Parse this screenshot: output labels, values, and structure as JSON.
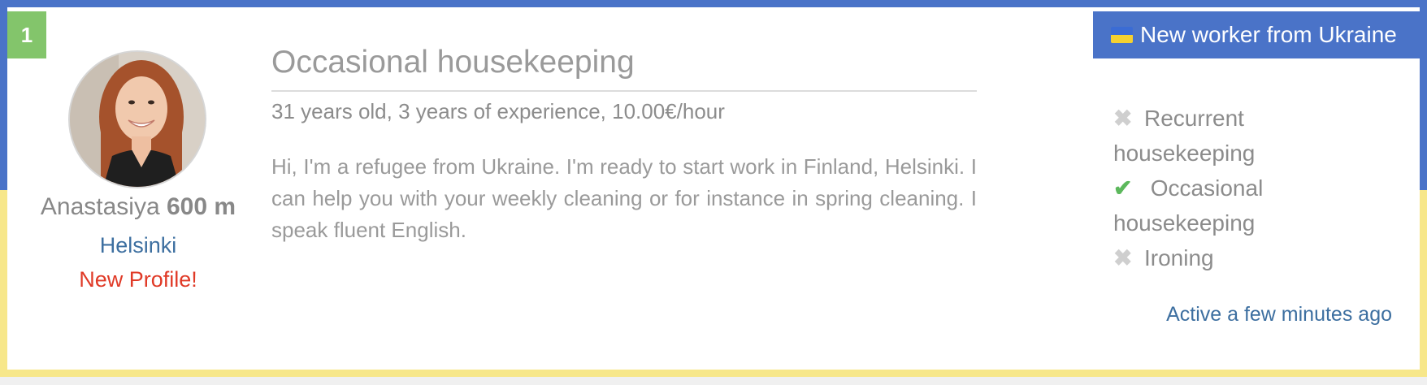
{
  "card": {
    "rank": "1",
    "badge_label": "New worker from Ukraine",
    "profile": {
      "first_name": "Anastasiya",
      "distance": "600 m",
      "city": "Helsinki",
      "new_label": "New Profile!"
    },
    "title": "Occasional housekeeping",
    "subtitle": "31 years old, 3 years of experience, 10.00€/hour",
    "description": "Hi, I'm a refugee from Ukraine. I'm ready to start work in Finland, Helsinki. I can help you with your weekly cleaning or for instance in spring cleaning. I speak fluent English.",
    "services": [
      {
        "label": "Recurrent housekeeping",
        "offered": false,
        "icon": "cross-icon"
      },
      {
        "label": "Occasional housekeeping",
        "offered": true,
        "icon": "check-icon"
      },
      {
        "label": "Ironing",
        "offered": false,
        "icon": "cross-icon"
      }
    ],
    "last_active": "Active a few minutes ago"
  },
  "colors": {
    "flag_blue": "#4a73c8",
    "flag_yellow": "#f7e78a",
    "rank_green": "#83c56b",
    "link_blue": "#3d6fa0",
    "new_red": "#e03a27",
    "check_green": "#5cb85c"
  }
}
